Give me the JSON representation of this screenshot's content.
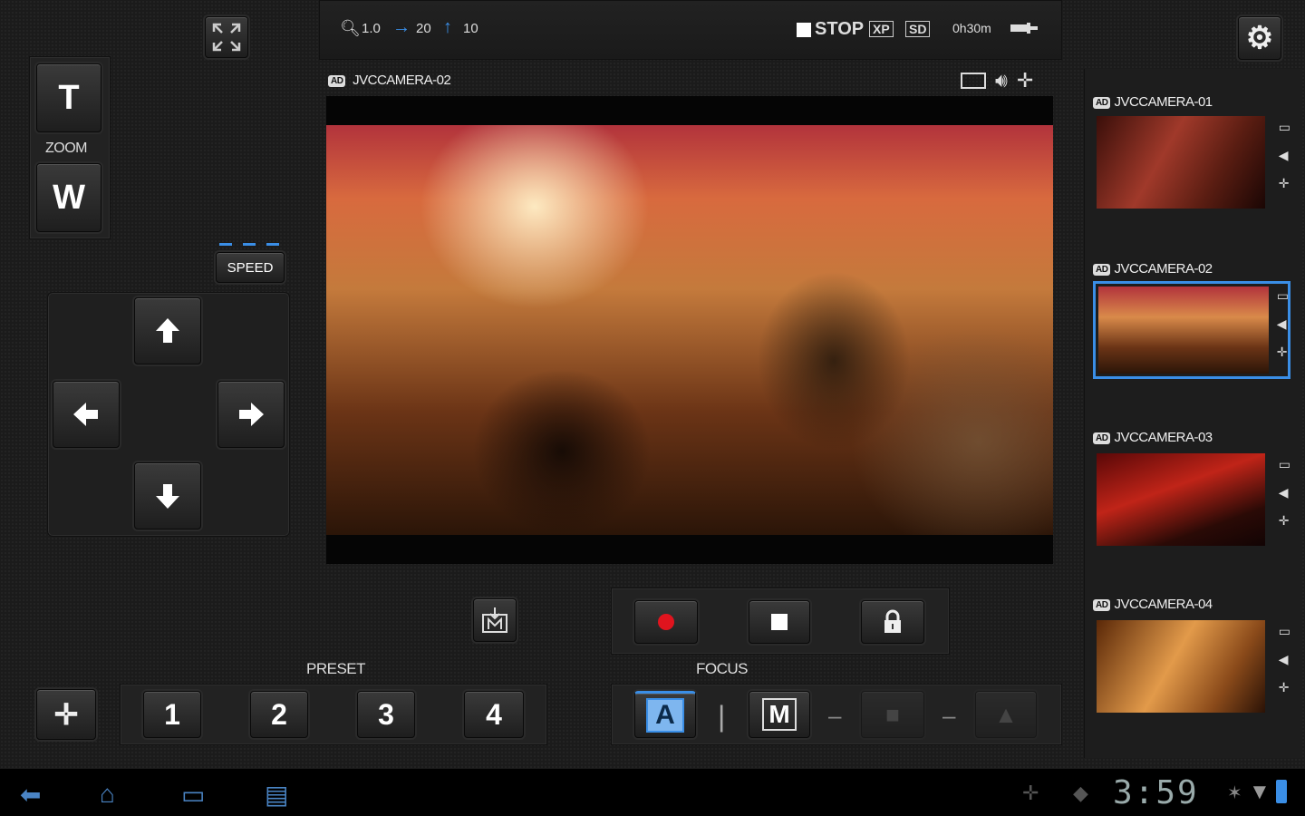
{
  "status_bar": {
    "zoom_value": "1.0",
    "pan_value": "20",
    "tilt_value": "10",
    "rec_state": "STOP",
    "mode_xp": "XP",
    "media_sd": "SD",
    "remaining": "0h30m"
  },
  "main_view": {
    "camera_label": "JVCCAMERA-02",
    "badge": "AD"
  },
  "zoom": {
    "tele": "T",
    "wide": "W",
    "label": "ZOOM"
  },
  "speed": {
    "label": "SPEED"
  },
  "preset": {
    "label": "PRESET",
    "buttons": [
      "1",
      "2",
      "3",
      "4"
    ]
  },
  "focus": {
    "label": "FOCUS",
    "auto": "A",
    "manual": "M",
    "separator": "|",
    "dash": "–"
  },
  "cameras": [
    {
      "badge": "AD",
      "name": "JVCCAMERA-01"
    },
    {
      "badge": "AD",
      "name": "JVCCAMERA-02"
    },
    {
      "badge": "AD",
      "name": "JVCCAMERA-03"
    },
    {
      "badge": "AD",
      "name": "JVCCAMERA-04"
    }
  ],
  "system": {
    "time": "3:59"
  },
  "icons": {
    "fullscreen": "fullscreen-icon",
    "settings": "gear-icon",
    "record": "record-icon",
    "stop": "stop-icon",
    "lock": "lock-icon",
    "memory": "memory-save-icon",
    "home_position": "home-position-icon"
  },
  "colors": {
    "accent": "#3a8ee6",
    "record": "#e0141e"
  }
}
